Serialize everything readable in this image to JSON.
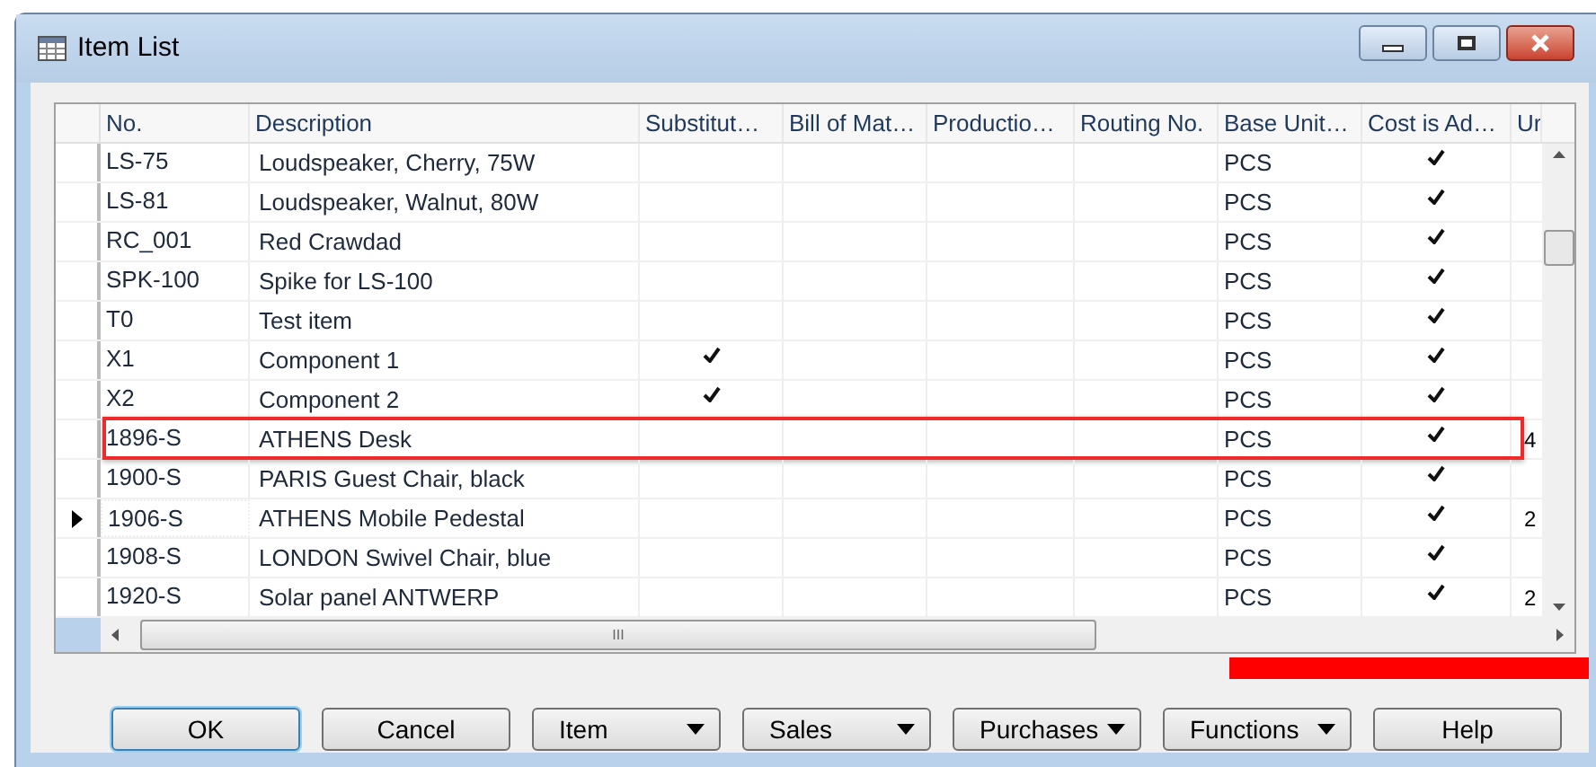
{
  "window": {
    "title": "Item List"
  },
  "table": {
    "columns": [
      "No.",
      "Description",
      "Substitut…",
      "Bill of Mat…",
      "Productio…",
      "Routing No.",
      "Base Unit…",
      "Cost is Ad…",
      "Ur"
    ],
    "rows": [
      {
        "no": "LS-75",
        "description": "Loudspeaker, Cherry, 75W",
        "substitutes": false,
        "base_unit": "PCS",
        "cost_adjusted": true,
        "current": false,
        "highlighted": false
      },
      {
        "no": "LS-81",
        "description": "Loudspeaker, Walnut, 80W",
        "substitutes": false,
        "base_unit": "PCS",
        "cost_adjusted": true,
        "current": false,
        "highlighted": false
      },
      {
        "no": "RC_001",
        "description": "Red Crawdad",
        "substitutes": false,
        "base_unit": "PCS",
        "cost_adjusted": true,
        "current": false,
        "highlighted": false
      },
      {
        "no": "SPK-100",
        "description": "Spike for LS-100",
        "substitutes": false,
        "base_unit": "PCS",
        "cost_adjusted": true,
        "current": false,
        "highlighted": false
      },
      {
        "no": "T0",
        "description": "Test item",
        "substitutes": false,
        "base_unit": "PCS",
        "cost_adjusted": true,
        "current": false,
        "highlighted": false
      },
      {
        "no": "X1",
        "description": "Component 1",
        "substitutes": true,
        "base_unit": "PCS",
        "cost_adjusted": true,
        "current": false,
        "highlighted": false
      },
      {
        "no": "X2",
        "description": "Component 2",
        "substitutes": true,
        "base_unit": "PCS",
        "cost_adjusted": true,
        "current": false,
        "highlighted": false
      },
      {
        "no": "1896-S",
        "description": "ATHENS Desk",
        "substitutes": false,
        "base_unit": "PCS",
        "cost_adjusted": true,
        "column_9": "4",
        "current": false,
        "highlighted": true
      },
      {
        "no": "1900-S",
        "description": "PARIS Guest Chair, black",
        "substitutes": false,
        "base_unit": "PCS",
        "cost_adjusted": true,
        "current": false,
        "highlighted": false
      },
      {
        "no": "1906-S",
        "description": "ATHENS Mobile Pedestal",
        "substitutes": false,
        "base_unit": "PCS",
        "cost_adjusted": true,
        "column_9": "2",
        "current": true,
        "highlighted": false
      },
      {
        "no": "1908-S",
        "description": "LONDON Swivel Chair, blue",
        "substitutes": false,
        "base_unit": "PCS",
        "cost_adjusted": true,
        "current": false,
        "highlighted": false
      },
      {
        "no": "1920-S",
        "description": "Solar panel ANTWERP",
        "substitutes": false,
        "base_unit": "PCS",
        "cost_adjusted": true,
        "column_9": "2",
        "current": false,
        "highlighted": false
      }
    ],
    "scrollbar_grip": "III"
  },
  "buttons": [
    {
      "label": "OK",
      "kind": "default"
    },
    {
      "label": "Cancel",
      "kind": "plain"
    },
    {
      "label": "Item",
      "kind": "menu"
    },
    {
      "label": "Sales",
      "kind": "menu"
    },
    {
      "label": "Purchases",
      "kind": "menu"
    },
    {
      "label": "Functions",
      "kind": "menu"
    },
    {
      "label": "Help",
      "kind": "plain"
    }
  ]
}
